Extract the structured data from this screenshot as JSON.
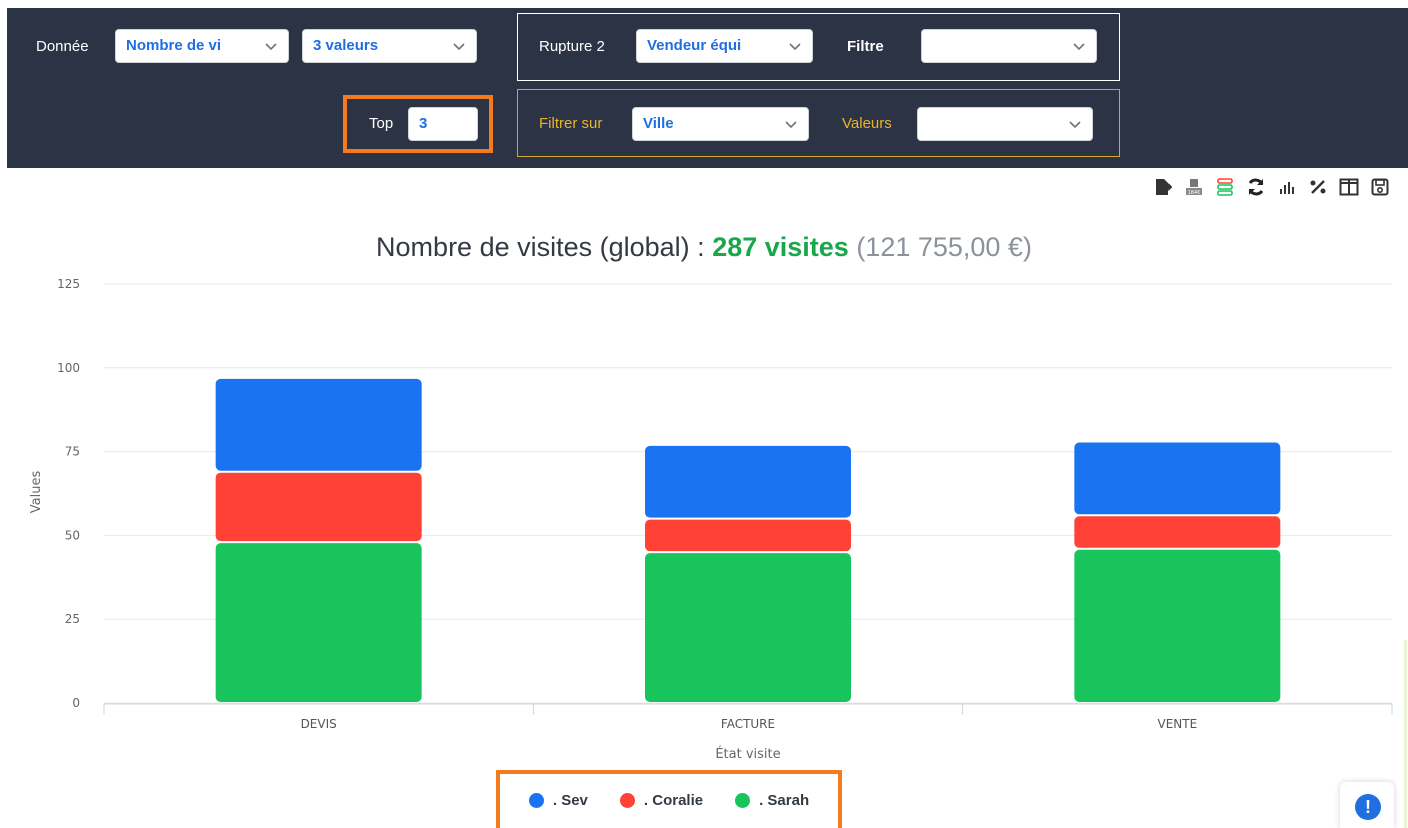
{
  "filters": {
    "donnee_label": "Donnée",
    "donnee_value": "Nombre de vi",
    "valeurs_count": "3 valeurs",
    "rupture2_label": "Rupture 2",
    "rupture2_value": "Vendeur équi",
    "filtre_label": "Filtre",
    "filtre_value": "",
    "top_label": "Top",
    "top_value": "3",
    "filtrer_sur_label": "Filtrer sur",
    "filtrer_sur_value": "Ville",
    "valeurs_label": "Valeurs",
    "valeurs_value": ""
  },
  "toolbar": {
    "icons": [
      "export-icon",
      "currency-icon",
      "stacked-series-icon",
      "refresh-icon",
      "bar-chart-icon",
      "percent-icon",
      "columns-icon",
      "save-icon"
    ]
  },
  "title": {
    "main": "Nombre de visites (global) : ",
    "highlight": "287 visites",
    "sub": "(121 755,00 €)"
  },
  "colors": {
    "sev": "#1a73f0",
    "coralie": "#ff4136",
    "sarah": "#19c45c",
    "header_bg": "#2c3344",
    "accent_orange": "#f47b20",
    "accent_gold": "#d4a72c"
  },
  "chart_data": {
    "type": "bar",
    "stacked": true,
    "categories": [
      "DEVIS",
      "FACTURE",
      "VENTE"
    ],
    "series": [
      {
        "name": ". Sarah",
        "values": [
          48,
          45,
          46
        ]
      },
      {
        "name": ". Coralie",
        "values": [
          21,
          10,
          10
        ]
      },
      {
        "name": ". Sev",
        "values": [
          28,
          22,
          22
        ]
      }
    ],
    "xlabel": "État visite",
    "ylabel": "Values",
    "ylim": [
      0,
      125
    ],
    "yticks": [
      "0",
      "25",
      "50",
      "75",
      "100",
      "125"
    ],
    "grid": true,
    "legend_position": "bottom"
  },
  "legend": {
    "items": [
      {
        "label": ". Sev"
      },
      {
        "label": ". Coralie"
      },
      {
        "label": ". Sarah"
      }
    ]
  },
  "help": {
    "symbol": "!"
  }
}
